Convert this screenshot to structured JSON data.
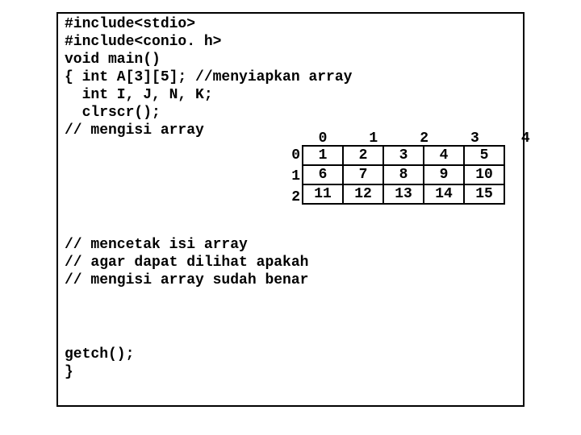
{
  "code": {
    "l0": "#include<stdio>",
    "l1": "#include<conio. h>",
    "l2": "void main()",
    "l3": "{ int A[3][5]; //menyiapkan array",
    "l4": "  int I, J, N, K;",
    "l5": "  clrscr();",
    "l6": "// mengisi array",
    "l7": "// mencetak isi array",
    "l8": "// agar dapat dilihat apakah",
    "l9": "// mengisi array sudah benar",
    "l10": "getch();",
    "l11": "}"
  },
  "chart_data": {
    "type": "table",
    "col_headers": [
      "0",
      "1",
      "2",
      "3",
      "4"
    ],
    "row_headers": [
      "0",
      "1",
      "2"
    ],
    "values": [
      [
        1,
        2,
        3,
        4,
        5
      ],
      [
        6,
        7,
        8,
        9,
        10
      ],
      [
        11,
        12,
        13,
        14,
        15
      ]
    ]
  }
}
